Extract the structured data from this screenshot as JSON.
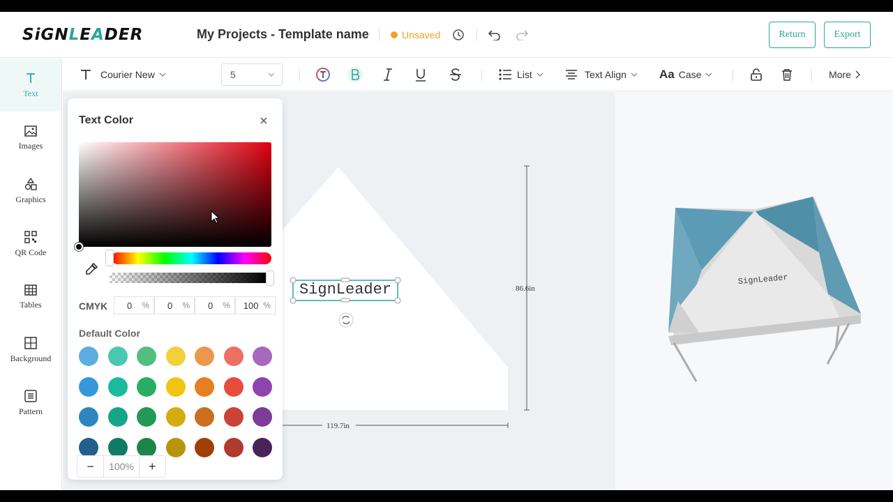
{
  "header": {
    "logo_prefix": "SiGN",
    "logo_accent": "L",
    "logo_suffix": "E",
    "logo_accent2": "A",
    "logo_suffix2": "DER",
    "project_title": "My Projects - Template name",
    "status": "Unsaved",
    "return_label": "Return",
    "export_label": "Export"
  },
  "toolbar": {
    "font_family": "Courier New",
    "font_size": "5",
    "list_label": "List",
    "text_align_label": "Text Align",
    "case_label": "Case",
    "more_label": "More"
  },
  "sidebar": {
    "items": [
      {
        "label": "Text",
        "icon": "text-icon"
      },
      {
        "label": "Images",
        "icon": "image-icon"
      },
      {
        "label": "Graphics",
        "icon": "shapes-icon"
      },
      {
        "label": "QR Code",
        "icon": "qr-code-icon"
      },
      {
        "label": "Tables",
        "icon": "table-icon"
      },
      {
        "label": "Background",
        "icon": "grid-icon"
      },
      {
        "label": "Pattern",
        "icon": "pattern-icon"
      }
    ]
  },
  "color_panel": {
    "title": "Text Color",
    "cmyk_label": "CMYK",
    "cmyk": {
      "c": "0",
      "m": "0",
      "y": "0",
      "k": "100"
    },
    "pct": "%",
    "default_label": "Default Color",
    "swatches": [
      "#5dade2",
      "#48c9b0",
      "#52be80",
      "#f4d03f",
      "#eb984e",
      "#ec7063",
      "#a569bd",
      "#3498db",
      "#1abc9c",
      "#27ae60",
      "#f1c40f",
      "#e67e22",
      "#e74c3c",
      "#8e44ad",
      "#2e86c1",
      "#17a589",
      "#229954",
      "#d4ac0d",
      "#ca6f1e",
      "#cb4335",
      "#7d3c98",
      "#21618c",
      "#117a65",
      "#1e8449",
      "#b7950b",
      "#a04000",
      "#b03a2e",
      "#4a235a"
    ]
  },
  "canvas": {
    "text_content": "SignLeader",
    "width_label": "119.7in",
    "height_label": "86.6in",
    "zoom": "100%"
  },
  "preview": {
    "text": "SignLeader"
  },
  "colors": {
    "accent": "#2aa79b",
    "warning": "#f0a12a"
  }
}
